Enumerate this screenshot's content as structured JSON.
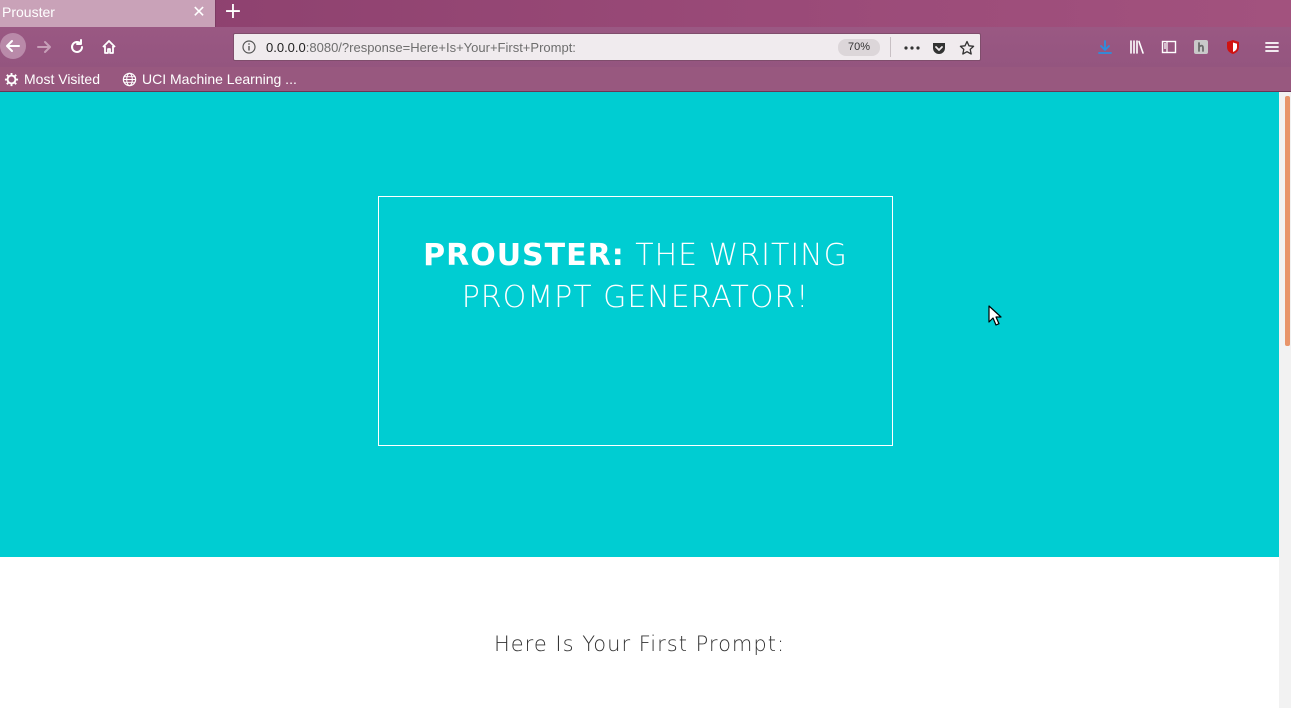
{
  "browser": {
    "tab": {
      "title": "Prouster"
    },
    "url": {
      "host": "0.0.0.0",
      "rest": ":8080/?response=Here+Is+Your+First+Prompt:",
      "zoom": "70%"
    },
    "bookmarks": [
      {
        "label": "Most Visited",
        "icon": "gear-icon"
      },
      {
        "label": "UCI Machine Learning ...",
        "icon": "globe-icon"
      }
    ]
  },
  "hero": {
    "brand": "PROUSTER:",
    "title_rest": "THE WRITING PROMPT GENERATOR!",
    "background": "#00cdd2"
  },
  "prompt": {
    "text": "Here Is Your First Prompt:"
  }
}
